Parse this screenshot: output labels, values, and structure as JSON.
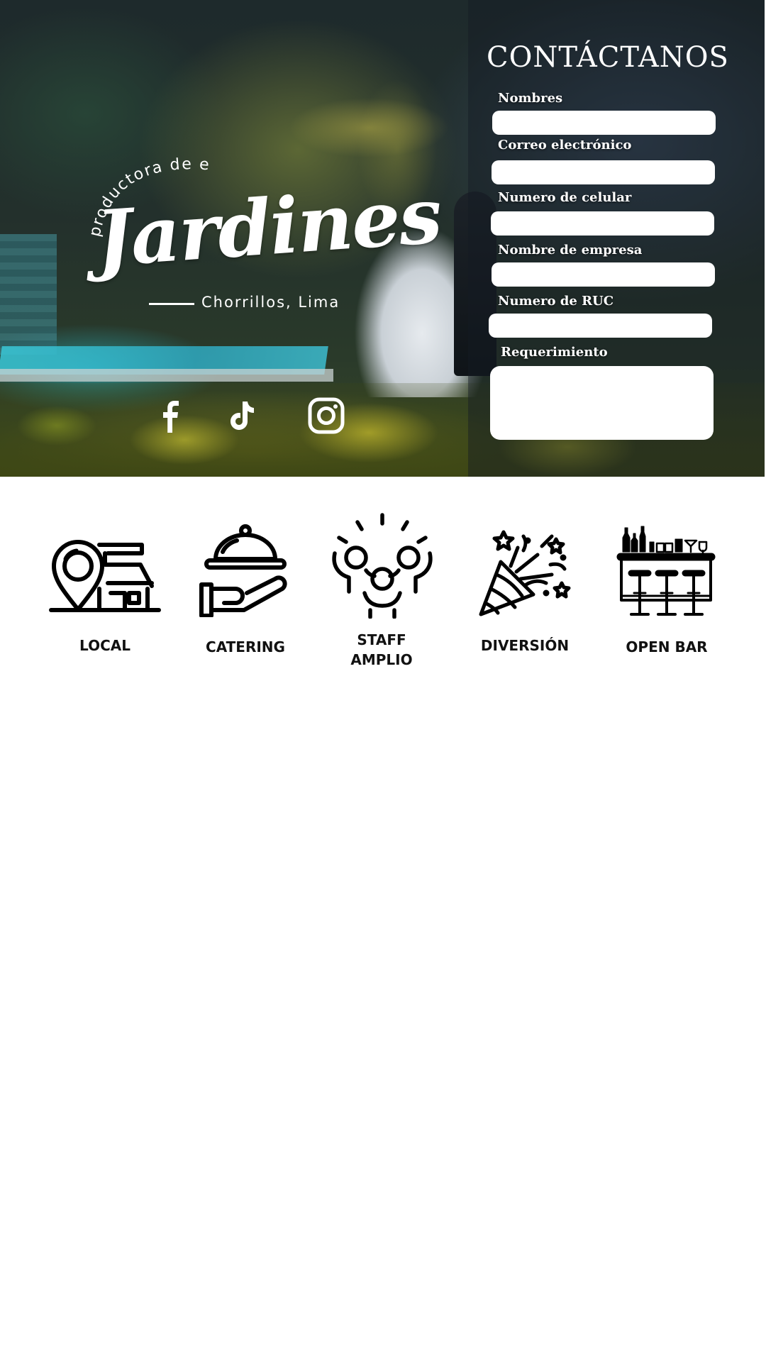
{
  "hero": {
    "brand": {
      "tagline": "productora de eventos",
      "name": "Jardines",
      "location": "Chorrillos, Lima"
    },
    "social": [
      {
        "icon": "facebook-icon"
      },
      {
        "icon": "tiktok-icon"
      },
      {
        "icon": "instagram-icon"
      }
    ]
  },
  "contact": {
    "title": "CONTÁCTANOS",
    "fields": {
      "nombres": {
        "label": "Nombres",
        "value": ""
      },
      "correo": {
        "label": "Correo electrónico",
        "value": ""
      },
      "celular": {
        "label": "Numero de celular",
        "value": ""
      },
      "empresa": {
        "label": "Nombre de empresa",
        "value": ""
      },
      "ruc": {
        "label": "Numero de RUC",
        "value": ""
      },
      "requerimiento": {
        "label": "Requerimiento",
        "value": ""
      }
    }
  },
  "services": [
    {
      "label": "LOCAL",
      "icon": "location-house-icon"
    },
    {
      "label": "CATERING",
      "icon": "serving-hand-icon"
    },
    {
      "label": "STAFF\nAMPLIO",
      "label_lines": [
        "STAFF",
        "AMPLIO"
      ],
      "icon": "team-icon"
    },
    {
      "label": "DIVERSIÓN",
      "icon": "party-popper-icon"
    },
    {
      "label": "OPEN BAR",
      "icon": "bar-counter-icon"
    }
  ],
  "colors": {
    "text_dark": "#111111",
    "white": "#ffffff",
    "panel": "#141a24"
  }
}
